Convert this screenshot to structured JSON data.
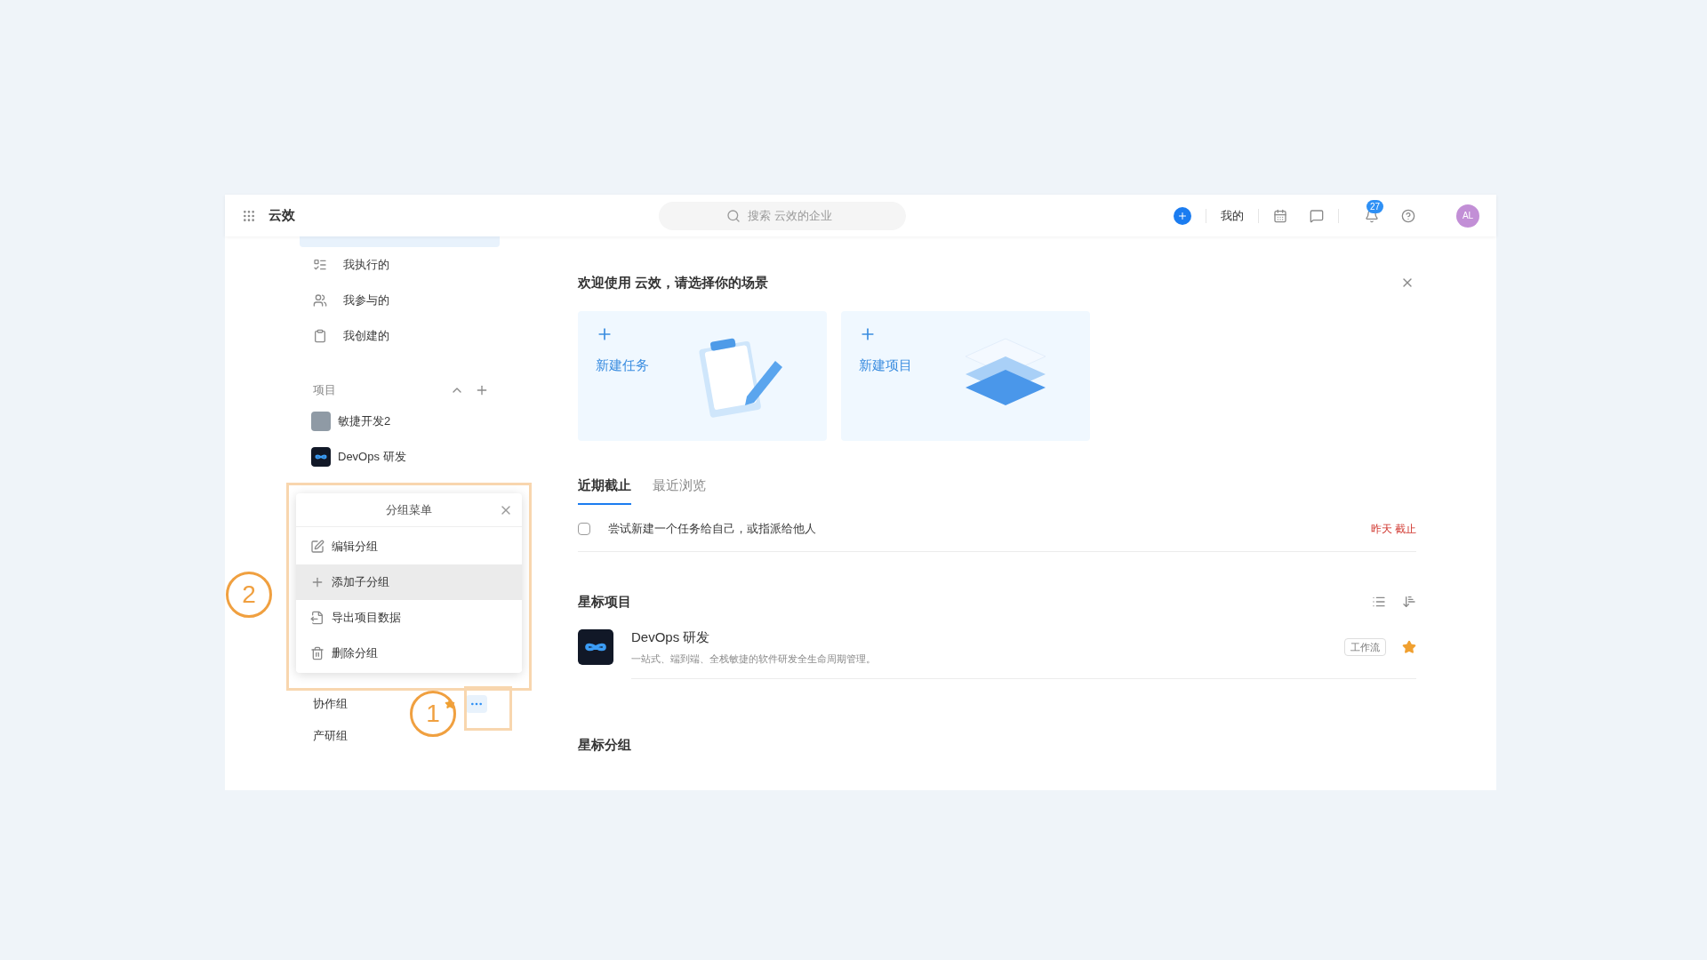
{
  "header": {
    "app_name": "云效",
    "search": {
      "placeholder": "搜索 云效的企业"
    },
    "my_label": "我的",
    "notification_count": "27",
    "avatar": "AL"
  },
  "sidebar": {
    "nav_items": [
      {
        "label": "我执行的",
        "kind": "assigned"
      },
      {
        "label": "我参与的",
        "kind": "participated"
      },
      {
        "label": "我创建的",
        "kind": "created"
      }
    ],
    "projects_section": {
      "title": "项目",
      "expanded": true
    },
    "projects": [
      {
        "name": "敏捷开发2",
        "kind": "photo"
      },
      {
        "name": "DevOps 研发",
        "kind": "devops"
      }
    ],
    "groups": [
      {
        "name": "协作组",
        "starred": true,
        "hovered": true
      },
      {
        "name": "产研组",
        "starred": false,
        "hovered": false
      }
    ]
  },
  "group_menu": {
    "title": "分组菜单",
    "items": [
      {
        "label": "编辑分组",
        "kind": "edit",
        "highlighted": false
      },
      {
        "label": "添加子分组",
        "kind": "add",
        "highlighted": true
      },
      {
        "label": "导出项目数据",
        "kind": "export",
        "highlighted": false
      },
      {
        "label": "删除分组",
        "kind": "delete",
        "highlighted": false
      }
    ]
  },
  "annotations": [
    {
      "label": "1"
    },
    {
      "label": "2"
    }
  ],
  "main": {
    "welcome": {
      "title": "欢迎使用 云效，请选择你的场景",
      "cards": [
        {
          "label": "新建任务",
          "kind": "task"
        },
        {
          "label": "新建项目",
          "kind": "project"
        }
      ]
    },
    "tabs": [
      {
        "label": "近期截止",
        "selected": true
      },
      {
        "label": "最近浏览",
        "selected": false
      }
    ],
    "tasks": [
      {
        "title": "尝试新建一个任务给自己，或指派给他人",
        "checked": false,
        "due": "昨天 截止"
      }
    ],
    "starred_projects": {
      "title": "星标项目",
      "items": [
        {
          "name": "DevOps 研发",
          "description": "一站式、端到端、全栈敏捷的软件研发全生命周期管理。",
          "tag": "工作流",
          "starred": true
        }
      ]
    },
    "starred_groups": {
      "title": "星标分组"
    }
  }
}
